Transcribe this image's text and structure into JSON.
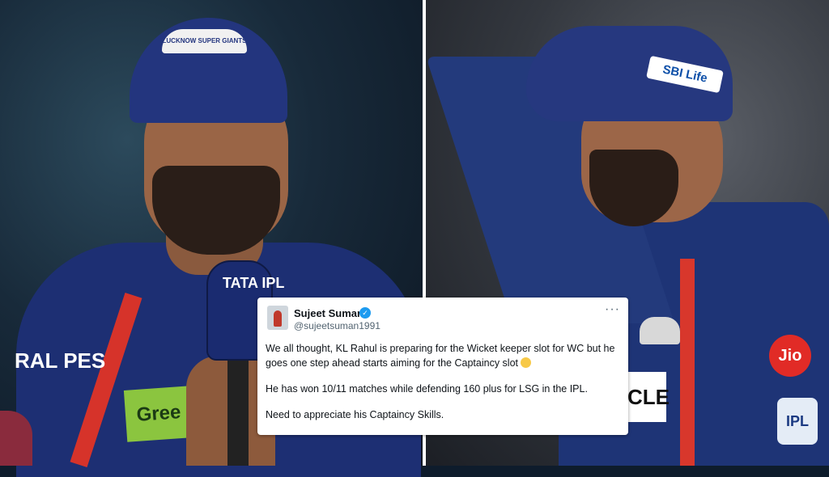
{
  "left_photo": {
    "cap_logo_text": "LUCKNOW SUPER GIANTS",
    "mic_text": "TATA IPL",
    "jersey_text": "RAL PES",
    "sponsor_patch": "Gree"
  },
  "right_photo": {
    "cap_sponsor": "SBI Life",
    "jio_badge": "Jio",
    "partial_sponsor": "CLE",
    "ipl_badge": "IPL"
  },
  "tweet": {
    "author_name": "Sujeet Suman",
    "author_handle": "@sujeetsuman1991",
    "more_label": "···",
    "paragraphs": [
      "We all thought, KL Rahul is preparing for the Wicket keeper slot for WC but he goes one step ahead starts aiming for the Captaincy slot",
      "He has won 10/11 matches while defending 160 plus for LSG in the IPL.",
      "Need to appreciate his Captaincy Skills."
    ]
  }
}
